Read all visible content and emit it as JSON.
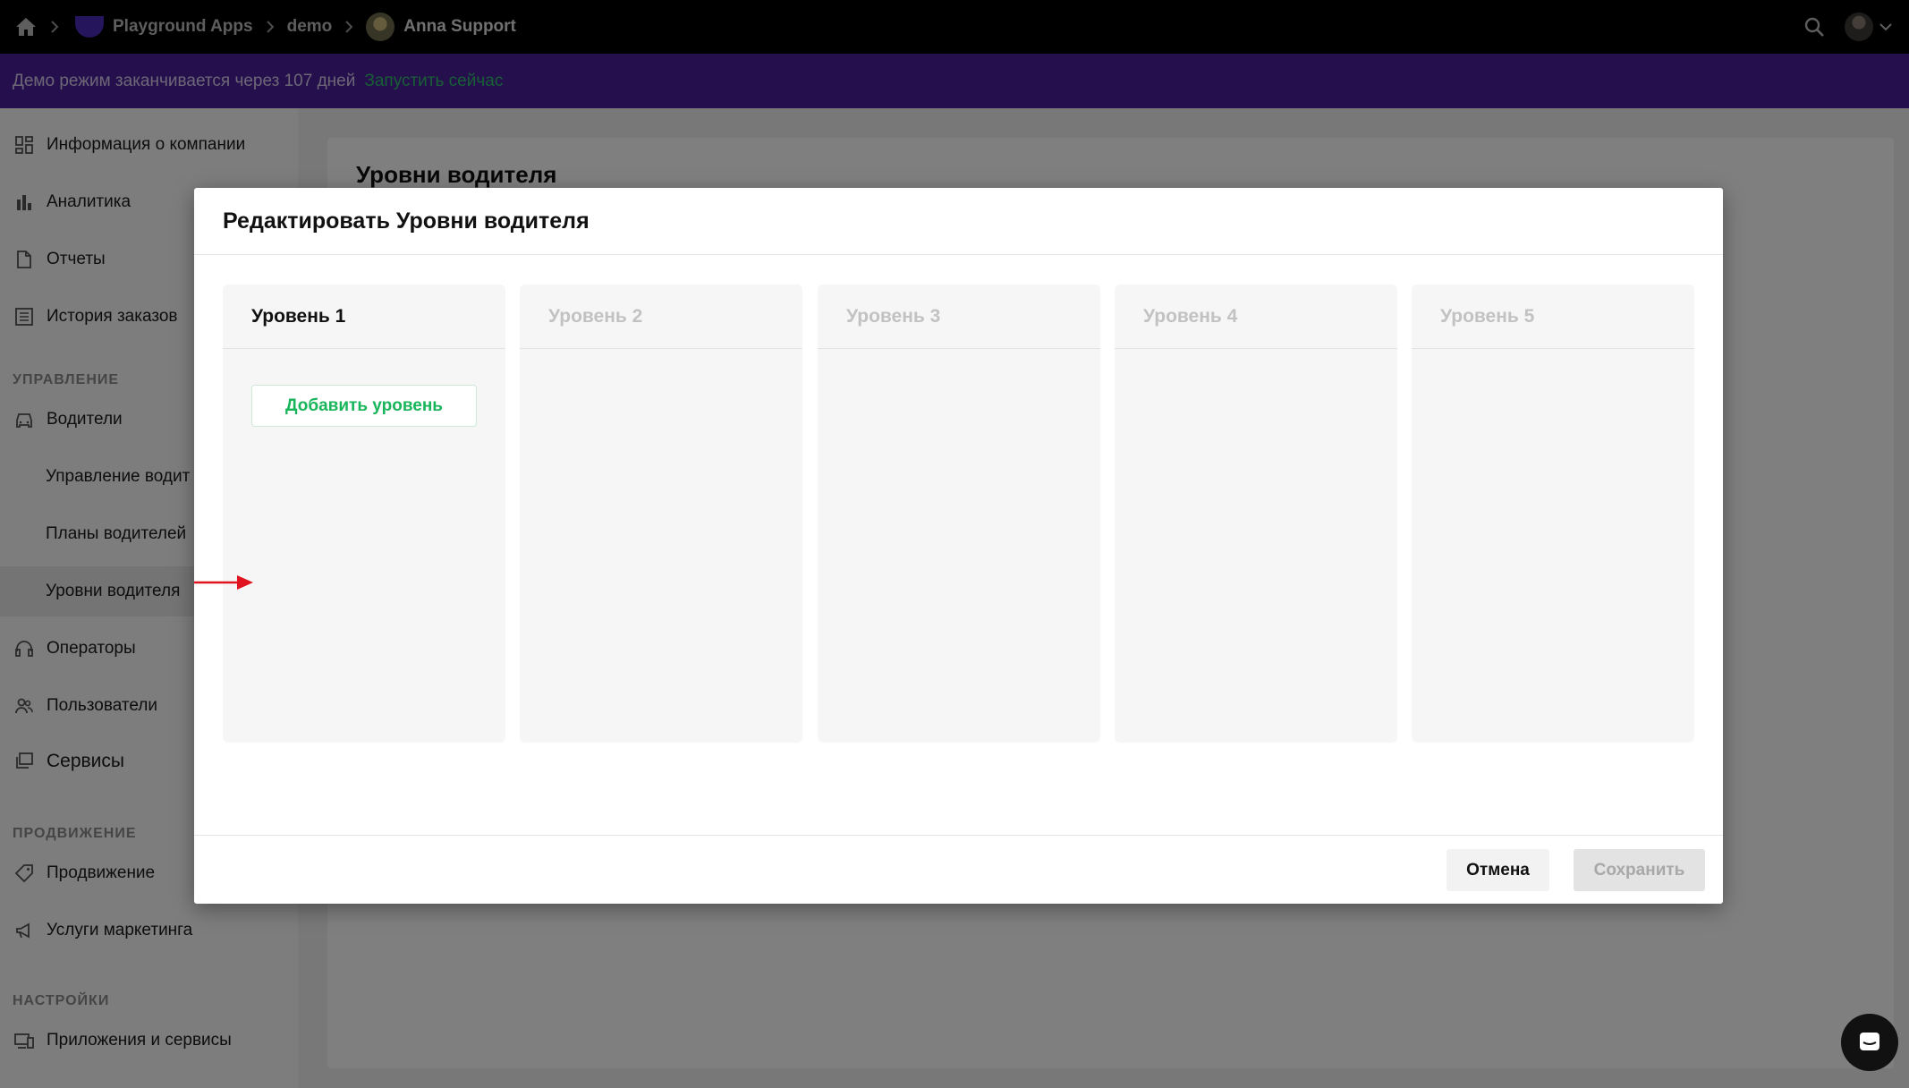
{
  "topbar": {
    "home_icon": "home-icon",
    "breadcrumbs": [
      {
        "label": "Playground Apps"
      },
      {
        "label": "demo"
      },
      {
        "label": "Anna Support"
      }
    ],
    "search_icon": "search-icon",
    "chevron_icon": "chevron-down-icon"
  },
  "banner": {
    "text": "Демо режим заканчивается через 107 дней",
    "link": "Запустить сейчас",
    "bg_color": "#4a1f98",
    "link_color": "#2fbf6a"
  },
  "sidebar": {
    "items_top": [
      {
        "label": "Информация о компании",
        "icon": "dashboard-icon"
      },
      {
        "label": "Аналитика",
        "icon": "bar-chart-icon"
      },
      {
        "label": "Отчеты",
        "icon": "document-icon"
      },
      {
        "label": "История заказов",
        "icon": "list-icon"
      }
    ],
    "section_management": "УПРАВЛЕНИЕ",
    "drivers": {
      "label": "Водители",
      "icon": "car-icon"
    },
    "driver_subitems": [
      {
        "label": "Управление водит"
      },
      {
        "label": "Планы водителей"
      },
      {
        "label": "Уровни водителя"
      }
    ],
    "operators": {
      "label": "Операторы",
      "icon": "headset-icon"
    },
    "users": {
      "label": "Пользователи",
      "icon": "users-icon"
    },
    "services": {
      "label": "Сервисы",
      "icon": "services-icon"
    },
    "section_promotion": "ПРОДВИЖЕНИЕ",
    "promotion": {
      "label": "Продвижение",
      "icon": "tag-icon"
    },
    "marketing": {
      "label": "Услуги маркетинга",
      "icon": "megaphone-icon"
    },
    "section_settings": "НАСТРОЙКИ",
    "apps": {
      "label": "Приложения и сервисы",
      "icon": "devices-icon"
    }
  },
  "main": {
    "title": "Уровни водителя"
  },
  "modal": {
    "title": "Редактировать Уровни водителя",
    "columns": [
      {
        "title": "Уровень 1",
        "active": true
      },
      {
        "title": "Уровень 2",
        "active": false
      },
      {
        "title": "Уровень 3",
        "active": false
      },
      {
        "title": "Уровень 4",
        "active": false
      },
      {
        "title": "Уровень 5",
        "active": false
      }
    ],
    "add_level_label": "Добавить уровень",
    "cancel_label": "Отмена",
    "save_label": "Сохранить",
    "accent_color": "#19b55a",
    "annotation_arrow_color": "#e0141e"
  },
  "chat_icon": "chat-icon"
}
